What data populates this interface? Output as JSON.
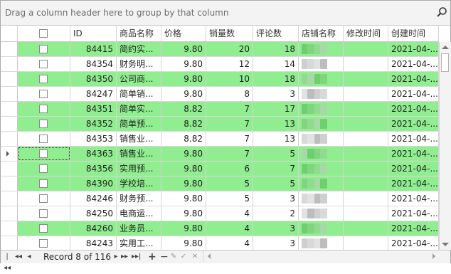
{
  "group_panel": {
    "hint": "Drag a column header here to group by that column"
  },
  "columns": [
    "ID",
    "商品名称",
    "价格",
    "销量数",
    "评论数",
    "店铺名称",
    "修改时间",
    "创建时间"
  ],
  "rows": [
    {
      "id": "84415",
      "name": "简约实...",
      "price": "9.80",
      "sales": "20",
      "reviews": "18",
      "created": "2021-04-...",
      "green": true
    },
    {
      "id": "84354",
      "name": "财务明...",
      "price": "9.80",
      "sales": "12",
      "reviews": "14",
      "created": "2021-04-...",
      "green": false
    },
    {
      "id": "84350",
      "name": "公司商...",
      "price": "9.80",
      "sales": "10",
      "reviews": "18",
      "created": "2021-04-...",
      "green": true
    },
    {
      "id": "84247",
      "name": "简单销...",
      "price": "9.80",
      "sales": "8",
      "reviews": "3",
      "created": "2021-04-...",
      "green": false
    },
    {
      "id": "84351",
      "name": "简单实...",
      "price": "8.82",
      "sales": "7",
      "reviews": "17",
      "created": "2021-04-...",
      "green": true
    },
    {
      "id": "84352",
      "name": "简单预...",
      "price": "8.82",
      "sales": "7",
      "reviews": "13",
      "created": "2021-04-...",
      "green": true
    },
    {
      "id": "84353",
      "name": "销售业...",
      "price": "8.82",
      "sales": "7",
      "reviews": "13",
      "created": "2021-04-...",
      "green": false
    },
    {
      "id": "84363",
      "name": "销售业...",
      "price": "9.80",
      "sales": "7",
      "reviews": "5",
      "created": "2021-04-...",
      "green": true,
      "focused": true
    },
    {
      "id": "84356",
      "name": "实用预...",
      "price": "9.80",
      "sales": "6",
      "reviews": "7",
      "created": "2021-04-...",
      "green": true
    },
    {
      "id": "84390",
      "name": "学校培...",
      "price": "9.80",
      "sales": "5",
      "reviews": "5",
      "created": "2021-04-...",
      "green": true
    },
    {
      "id": "84246",
      "name": "财务预...",
      "price": "9.80",
      "sales": "5",
      "reviews": "3",
      "created": "2021-04-...",
      "green": false
    },
    {
      "id": "84250",
      "name": "电商运...",
      "price": "9.80",
      "sales": "4",
      "reviews": "2",
      "created": "2021-04-...",
      "green": false
    },
    {
      "id": "84260",
      "name": "业务员...",
      "price": "9.80",
      "sales": "4",
      "reviews": "3",
      "created": "2021-04-...",
      "green": true
    },
    {
      "id": "84243",
      "name": "实用工...",
      "price": "9.80",
      "sales": "4",
      "reviews": "3",
      "created": "2021-04-...",
      "green": false
    }
  ],
  "navigator": {
    "record_text": "Record 8 of 116"
  },
  "colors": {
    "highlight_row": "#90ee90"
  }
}
